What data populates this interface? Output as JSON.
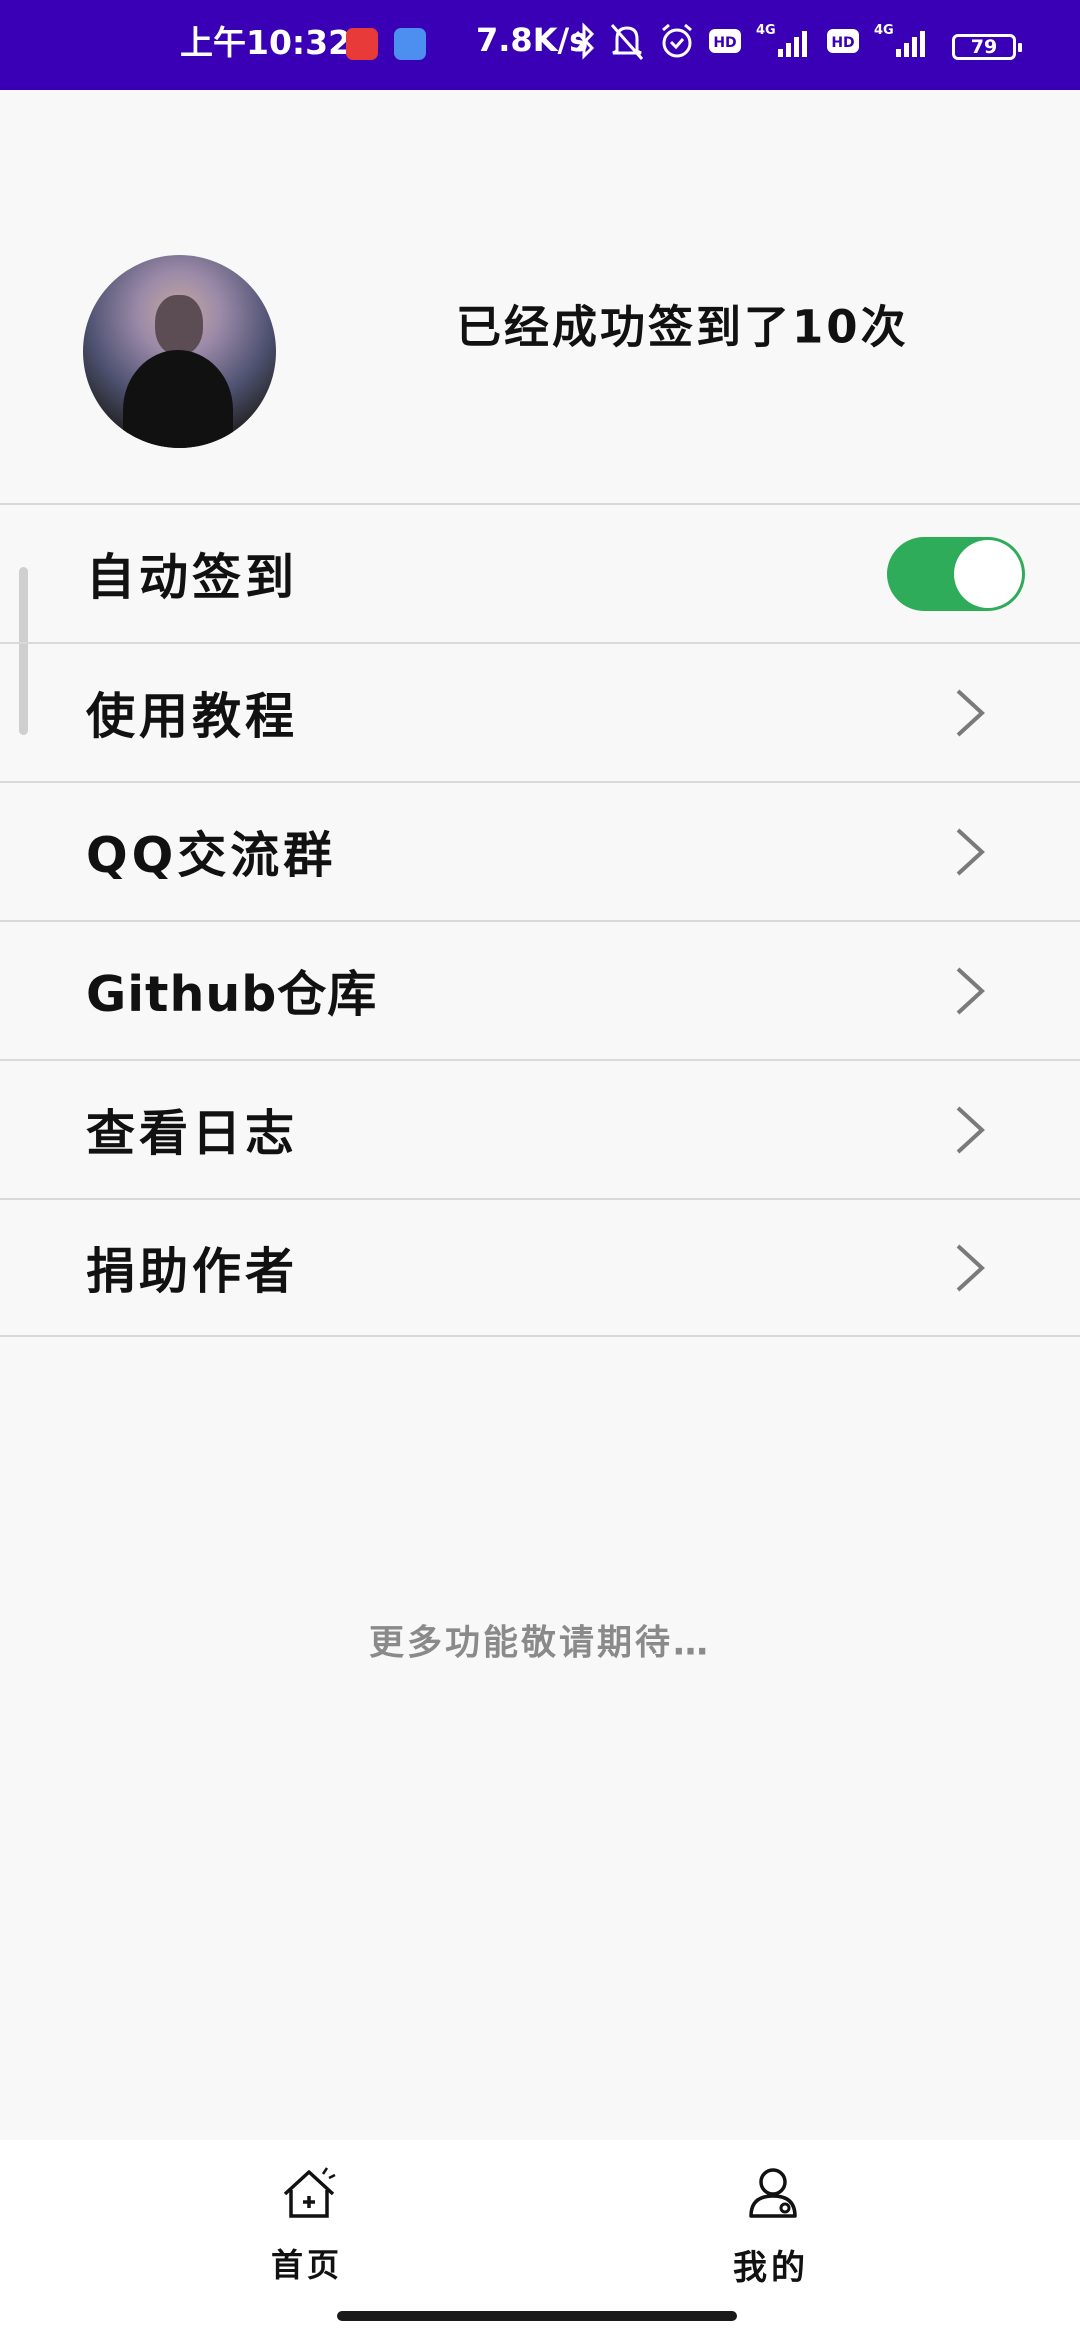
{
  "status_bar": {
    "time": "上午10:32",
    "network_speed": "7.8K/s",
    "battery_level": "79",
    "background_color": "#3a00b6",
    "icons": [
      "netease-music-icon",
      "app-icon",
      "bluetooth-icon",
      "mute-bell-icon",
      "alarm-icon",
      "hd-icon",
      "signal-4g-icon",
      "hd-icon",
      "signal-4g-icon",
      "battery-icon"
    ]
  },
  "profile": {
    "sign_count_text": "已经成功签到了10次"
  },
  "menu": {
    "items": [
      {
        "label": "自动签到",
        "control": "toggle",
        "toggle_on": true
      },
      {
        "label": "使用教程",
        "control": "chevron"
      },
      {
        "label": "QQ交流群",
        "control": "chevron"
      },
      {
        "label": "Github仓库",
        "control": "chevron"
      },
      {
        "label": "查看日志",
        "control": "chevron"
      },
      {
        "label": "捐助作者",
        "control": "chevron"
      }
    ]
  },
  "footer_text": "更多功能敬请期待…",
  "bottom_nav": {
    "home_label": "首页",
    "mine_label": "我的"
  },
  "colors": {
    "accent_toggle": "#2eac5a",
    "page_background": "#f8f8f8"
  }
}
